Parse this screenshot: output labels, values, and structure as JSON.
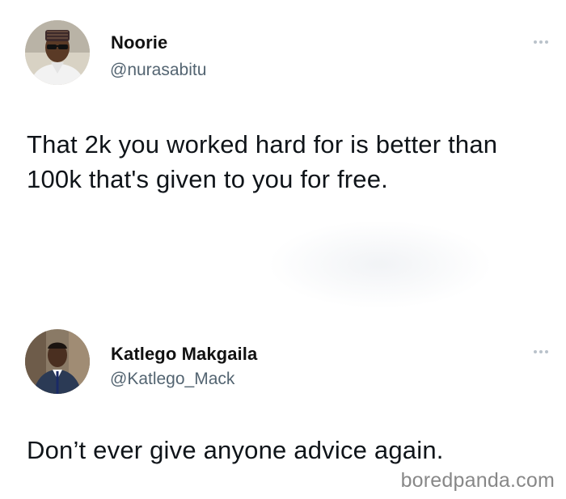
{
  "tweets": [
    {
      "display_name": "Noorie",
      "handle": "@nurasabitu",
      "text": "That 2k you worked hard for is better than 100k that's given to you for free.",
      "avatar_icon": "user-avatar-icon"
    },
    {
      "display_name": "Katlego Makgaila",
      "handle": "@Katlego_Mack",
      "text": "Don’t ever give anyone advice again.",
      "avatar_icon": "user-avatar-icon"
    }
  ],
  "watermark": "boredpanda.com",
  "colors": {
    "text": "#0f1419",
    "handle": "#536471",
    "more_dots": "#b9c2ca",
    "watermark": "#888888"
  }
}
